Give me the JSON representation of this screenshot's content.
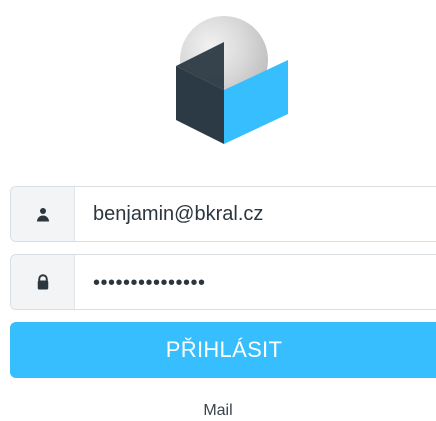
{
  "login": {
    "username_value": "benjamin@bkral.cz",
    "password_mask": "•••••••••••••••",
    "submit_label": "PŘIHLÁSIT",
    "product_name": "Mail"
  },
  "icons": {
    "logo": "roundcube-logo",
    "username": "user-icon",
    "password": "lock-icon"
  },
  "colors": {
    "accent": "#37beff",
    "logo_dark": "#2c3a45",
    "logo_blue": "#37beff",
    "logo_sphere": "#d9d9d9"
  }
}
